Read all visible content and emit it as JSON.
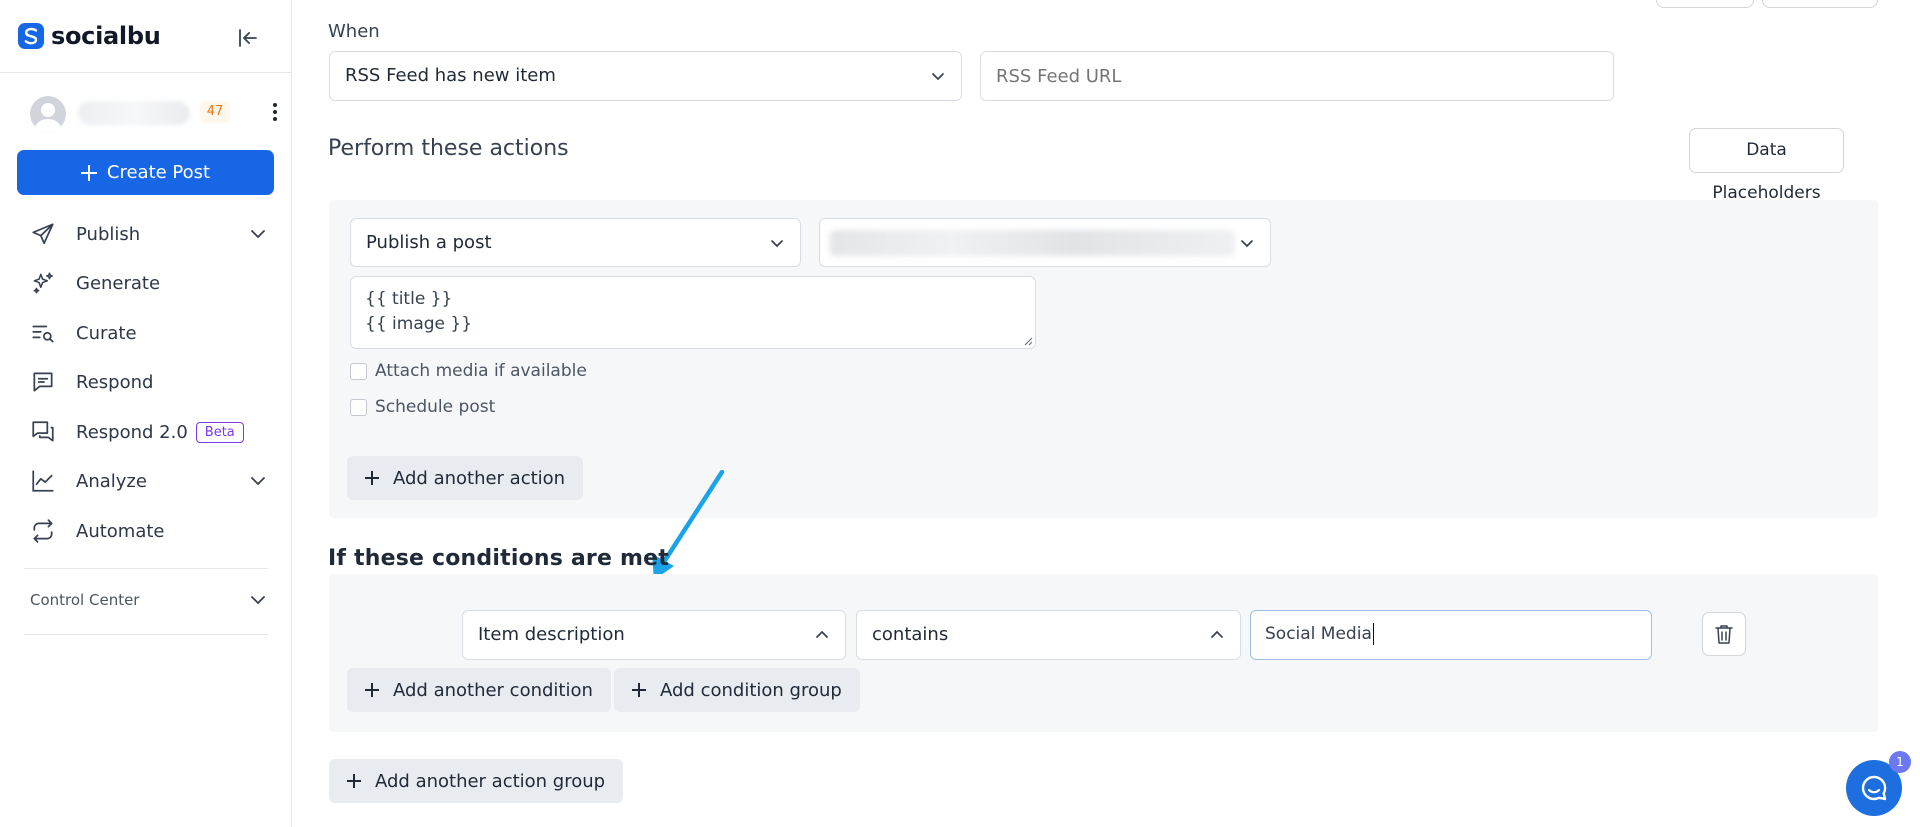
{
  "brand": {
    "name": "socialbu"
  },
  "profile": {
    "count": "47"
  },
  "sidebar": {
    "create_post": "Create Post",
    "items": [
      {
        "label": "Publish",
        "icon": "send-icon",
        "has_chevron": true
      },
      {
        "label": "Generate",
        "icon": "sparkles-icon",
        "has_chevron": false
      },
      {
        "label": "Curate",
        "icon": "curate-search-icon",
        "has_chevron": false
      },
      {
        "label": "Respond",
        "icon": "message-square-icon",
        "has_chevron": false
      },
      {
        "label": "Respond 2.0",
        "icon": "messages-icon",
        "badge": "Beta",
        "has_chevron": false
      },
      {
        "label": "Analyze",
        "icon": "line-chart-icon",
        "has_chevron": true
      },
      {
        "label": "Automate",
        "icon": "repeat-icon",
        "has_chevron": false
      }
    ],
    "control_center": "Control Center"
  },
  "trigger": {
    "label": "When",
    "selected": "RSS Feed has new item",
    "url_placeholder": "RSS Feed URL"
  },
  "actions": {
    "title": "Perform these actions",
    "data_placeholders_button": "Data Placeholders",
    "action_type": "Publish a post",
    "template_lines": [
      "{{ title }}",
      "{{ image }}"
    ],
    "checkboxes": [
      "Attach media if available",
      "Schedule post"
    ],
    "add_action": "Add another action"
  },
  "conditions": {
    "title": "If these conditions are met",
    "field": "Item description",
    "operator": "contains",
    "value": "Social Media",
    "add_condition": "Add another condition",
    "add_group": "Add condition group"
  },
  "add_action_group": "Add another action group",
  "chat": {
    "badge": "1"
  },
  "colors": {
    "primary": "#1766e6",
    "beta": "#7c3aed",
    "arrow": "#1aa3e8"
  }
}
